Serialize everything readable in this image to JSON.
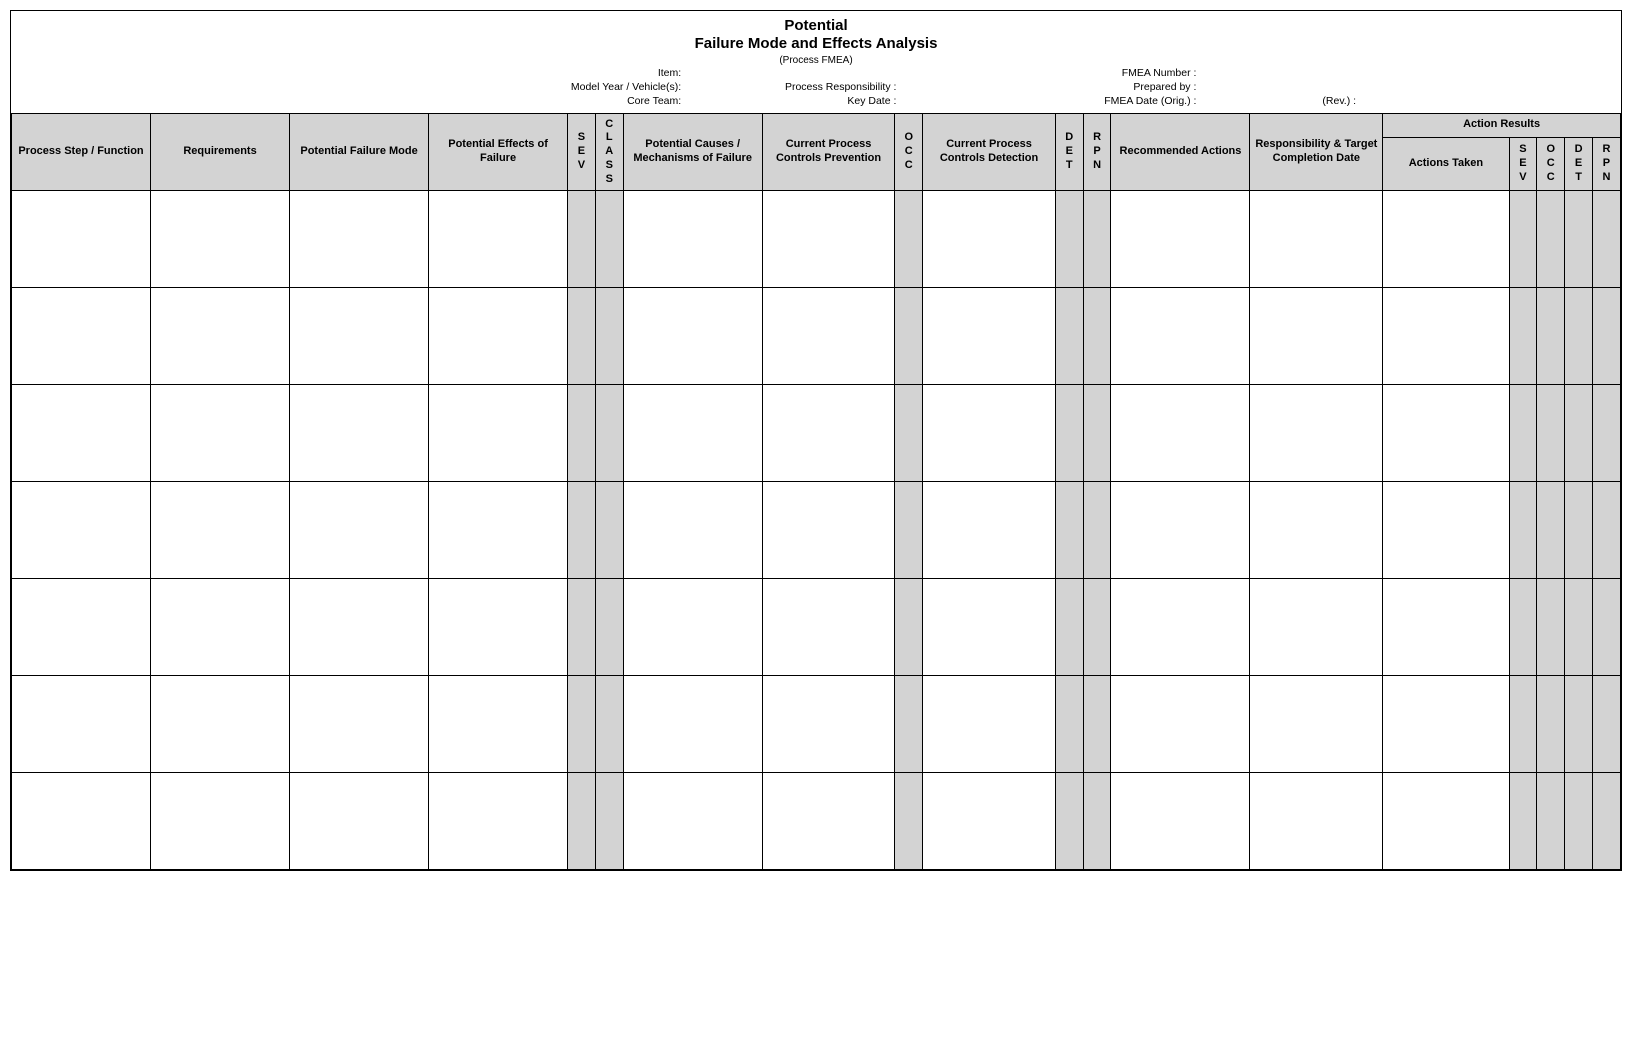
{
  "title": {
    "line1": "Potential",
    "line2": "Failure Mode and Effects Analysis",
    "sub": "(Process FMEA)"
  },
  "meta": {
    "left": {
      "item": "Item:",
      "modelyear": "Model Year / Vehicle(s):",
      "coreteam": "Core Team:",
      "processresp": "Process Responsibility :",
      "keydate": "Key Date :"
    },
    "right": {
      "fmeanumber": "FMEA Number :",
      "preparedby": "Prepared by :",
      "fmeadate": "FMEA Date (Orig.) :",
      "rev": "(Rev.) :"
    }
  },
  "headers": {
    "processstep": "Process Step / Function",
    "requirements": "Requirements",
    "failmode": "Potential Failure Mode",
    "effects": "Potential Effects of Failure",
    "sev": "SEV",
    "class": "CLASS",
    "causes": "Potential Causes / Mechanisms of Failure",
    "prevention": "Current Process Controls Prevention",
    "occ": "OCC",
    "detection": "Current Process Controls Detection",
    "det": "DET",
    "rpn": "RPN",
    "recommended": "Recommended Actions",
    "responsibility": "Responsibility & Target Completion Date",
    "actionresults": "Action Results",
    "actionstaken": "Actions Taken",
    "sev2": "SEV",
    "occ2": "OCC",
    "det2": "DET",
    "rpn2": "RPN"
  },
  "rows": [
    {},
    {},
    {},
    {},
    {},
    {},
    {}
  ]
}
